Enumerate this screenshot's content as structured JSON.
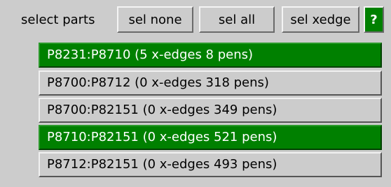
{
  "header": {
    "label": "select parts",
    "sel_none": "sel none",
    "sel_all": "sel all",
    "sel_xedge": "sel xedge",
    "help": "?"
  },
  "colors": {
    "background": "#cccccc",
    "selected": "#008000",
    "selected_text": "#ffffff"
  },
  "parts": [
    {
      "label": "P8231:P8710 (5 x-edges 8 pens)",
      "selected": true
    },
    {
      "label": "P8700:P8712 (0 x-edges 318 pens)",
      "selected": false
    },
    {
      "label": "P8700:P82151 (0 x-edges 349 pens)",
      "selected": false
    },
    {
      "label": "P8710:P82151 (0 x-edges 521 pens)",
      "selected": true
    },
    {
      "label": "P8712:P82151 (0 x-edges 493 pens)",
      "selected": false
    }
  ]
}
